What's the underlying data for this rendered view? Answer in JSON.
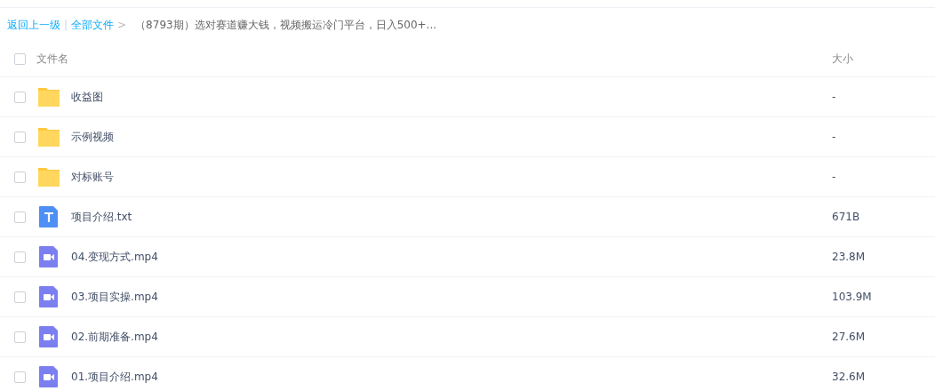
{
  "breadcrumb": {
    "back": "返回上一级",
    "separator": "|",
    "root": "全部文件",
    "arrow": ">",
    "current": "（8793期）选对赛道赚大钱，视频搬运冷门平台，日入500+..."
  },
  "table": {
    "columns": [
      "文件名",
      "大小"
    ],
    "all_checked": false,
    "rows": [
      {
        "kind": "folder",
        "name": "收益图",
        "size": "-",
        "checked": false
      },
      {
        "kind": "folder",
        "name": "示例视频",
        "size": "-",
        "checked": false
      },
      {
        "kind": "folder",
        "name": "对标账号",
        "size": "-",
        "checked": false
      },
      {
        "kind": "text",
        "name": "项目介绍.txt",
        "size": "671B",
        "checked": false
      },
      {
        "kind": "video",
        "name": "04.变现方式.mp4",
        "size": "23.8M",
        "checked": false
      },
      {
        "kind": "video",
        "name": "03.项目实操.mp4",
        "size": "103.9M",
        "checked": false
      },
      {
        "kind": "video",
        "name": "02.前期准备.mp4",
        "size": "27.6M",
        "checked": false
      },
      {
        "kind": "video",
        "name": "01.项目介绍.mp4",
        "size": "32.6M",
        "checked": false
      }
    ]
  }
}
